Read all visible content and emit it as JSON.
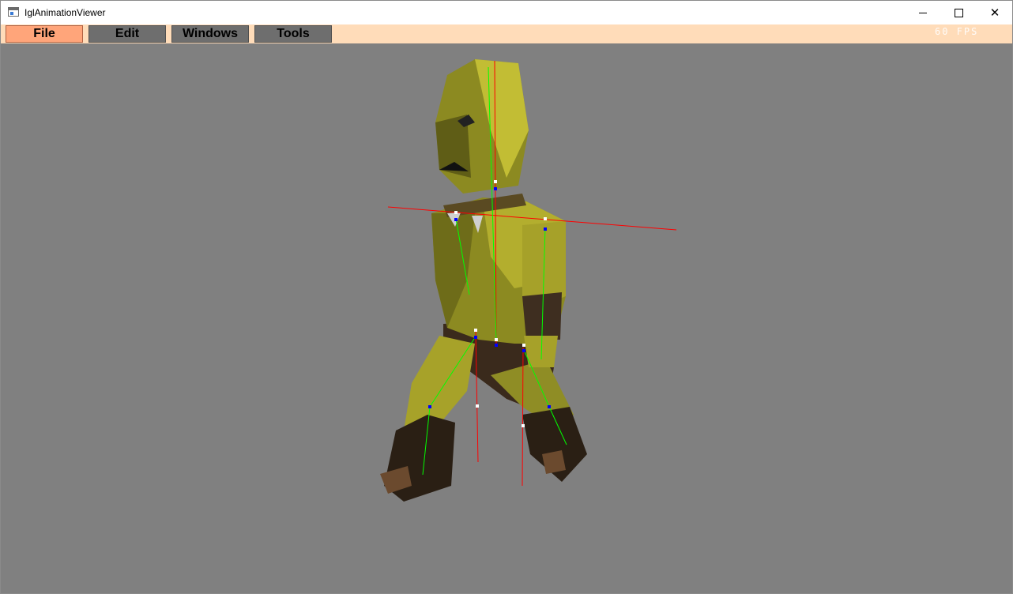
{
  "window": {
    "title": "IglAnimationViewer",
    "minimize_icon": "minimize-icon",
    "maximize_icon": "maximize-icon",
    "close_icon": "close-icon"
  },
  "menu": {
    "items": [
      {
        "label": "File",
        "active": true
      },
      {
        "label": "Edit",
        "active": false
      },
      {
        "label": "Windows",
        "active": false
      },
      {
        "label": "Tools",
        "active": false
      }
    ],
    "fps_label": "60 FPS"
  },
  "viewport": {
    "background_color": "#808080",
    "model": "character-with-skeleton-overlay"
  },
  "colors": {
    "menubar_bg": "#ffdcb9",
    "menu_active_bg": "#ffa57a",
    "menu_inactive_bg": "#6e6e6e",
    "bone_line": "#00ff00",
    "axis_line": "#ff0000",
    "joint_marker": "#0000ff"
  }
}
